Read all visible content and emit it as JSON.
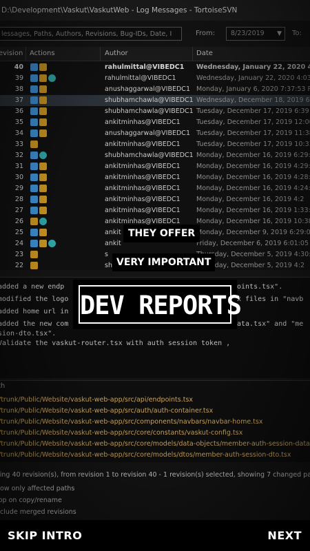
{
  "window": {
    "title": "D:\\Development\\Vaskut\\VaskutWeb - Log Messages - TortoiseSVN"
  },
  "filter": {
    "search_placeholder": "lessages, Paths, Authors, Revisions, Bug-IDs, Date, I",
    "from_label": "From:",
    "from_date": "8/23/2019",
    "to_label": "To:"
  },
  "log_table": {
    "columns": [
      "evision",
      "Actions",
      "Author",
      "Date"
    ],
    "rows": [
      {
        "rev": "40",
        "actions": [
          "a",
          "m"
        ],
        "author": "rahulmittal@VIBEDC1",
        "date": "Wednesday, January 22, 2020 4:0",
        "bold": true,
        "selected": false
      },
      {
        "rev": "39",
        "actions": [
          "a",
          "m",
          "d"
        ],
        "author": "rahulmittal@VIBEDC1",
        "date": "Wednesday, January 22, 2020 4:03",
        "bold": false,
        "selected": false
      },
      {
        "rev": "38",
        "actions": [
          "a",
          "m"
        ],
        "author": "anushaggarwal@VIBEDC1",
        "date": "Monday, January 6, 2020 7:37:53 P",
        "bold": false,
        "selected": false
      },
      {
        "rev": "37",
        "actions": [
          "a",
          "m"
        ],
        "author": "shubhamchawla@VIBEDC1",
        "date": "Wednesday, December 18, 2019 6:",
        "bold": false,
        "selected": true
      },
      {
        "rev": "36",
        "actions": [
          "a",
          "m"
        ],
        "author": "shubhamchawla@VIBEDC1",
        "date": "Tuesday, December 17, 2019 6:39",
        "bold": false,
        "selected": false
      },
      {
        "rev": "35",
        "actions": [
          "a",
          "m"
        ],
        "author": "ankitminhas@VIBEDC1",
        "date": "Tuesday, December 17, 2019 12:00",
        "bold": false,
        "selected": false
      },
      {
        "rev": "34",
        "actions": [
          "a",
          "m"
        ],
        "author": "anushaggarwal@VIBEDC1",
        "date": "Tuesday, December 17, 2019 11:38",
        "bold": false,
        "selected": false
      },
      {
        "rev": "33",
        "actions": [
          "m"
        ],
        "author": "ankitminhas@VIBEDC1",
        "date": "Tuesday, December 17, 2019 10:33",
        "bold": false,
        "selected": false
      },
      {
        "rev": "32",
        "actions": [
          "a",
          "d"
        ],
        "author": "shubhamchawla@VIBEDC1",
        "date": "Monday, December 16, 2019 6:29:",
        "bold": false,
        "selected": false
      },
      {
        "rev": "31",
        "actions": [
          "a",
          "m"
        ],
        "author": "ankitminhas@VIBEDC1",
        "date": "Monday, December 16, 2019 4:29:",
        "bold": false,
        "selected": false
      },
      {
        "rev": "30",
        "actions": [
          "a",
          "m"
        ],
        "author": "ankitminhas@VIBEDC1",
        "date": "Monday, December 16, 2019 4:28:",
        "bold": false,
        "selected": false
      },
      {
        "rev": "29",
        "actions": [
          "a",
          "m"
        ],
        "author": "ankitminhas@VIBEDC1",
        "date": "Monday, December 16, 2019 4:24:",
        "bold": false,
        "selected": false
      },
      {
        "rev": "28",
        "actions": [
          "a",
          "m"
        ],
        "author": "ankitminhas@VIBEDC1",
        "date": "Monday, December 16, 2019 4:2",
        "bold": false,
        "selected": false
      },
      {
        "rev": "27",
        "actions": [
          "a",
          "m"
        ],
        "author": "ankitminhas@VIBEDC1",
        "date": "Monday, December 16, 2019 1:33:",
        "bold": false,
        "selected": false
      },
      {
        "rev": "26",
        "actions": [
          "m",
          "d"
        ],
        "author": "ankitminhas@VIBEDC1",
        "date": "Monday, December 16, 2019 10:38",
        "bold": false,
        "selected": false
      },
      {
        "rev": "25",
        "actions": [
          "a",
          "m"
        ],
        "author": "ankit",
        "date": "Monday, December 9, 2019 6:29:0",
        "bold": false,
        "selected": false
      },
      {
        "rev": "24",
        "actions": [
          "a",
          "m",
          "d"
        ],
        "author": "ankit",
        "date": "Friday, December 6, 2019 6:01:05 P",
        "bold": false,
        "selected": false
      },
      {
        "rev": "23",
        "actions": [
          "m"
        ],
        "author": "s",
        "date": "Thursday, December 5, 2019 4:30:2",
        "bold": false,
        "selected": false
      },
      {
        "rev": "22",
        "actions": [
          "m"
        ],
        "author": "sh",
        "date": "Thursday, December 5, 2019 4:2",
        "bold": false,
        "selected": false
      }
    ]
  },
  "message": {
    "lines": [
      "added a new endp",
      "modified the logo",
      "added home url in",
      "added the new com",
      "sion-dto.tsx\".",
      "Validate the vaskut-router.tsx with auth session token ,"
    ],
    "fragments": [
      "oints.tsx\".",
      "x files in \"navb",
      "ata.tsx\" and \"me"
    ]
  },
  "paths": {
    "header": "th",
    "rows": [
      "/trunk/Public/Website/vaskut-web-app/src/api/endpoints.tsx",
      "/trunk/Public/Website/vaskut-web-app/src/auth/auth-container.tsx",
      "/trunk/Public/Website/vaskut-web-app/src/components/navbars/navbar-home.tsx",
      "/trunk/Public/Website/vaskut-web-app/src/core/constants/vaskut-config.tsx",
      "/trunk/Public/Website/vaskut-web-app/src/core/models/data-objects/member-auth-session-data.tsx",
      "/trunk/Public/Website/vaskut-web-app/src/core/models/dtos/member-auth-session-dto.tsx"
    ]
  },
  "status": {
    "text": "wing 40 revision(s), from revision 1 to revision 40 - 1 revision(s) selected, showing 7 changed paths"
  },
  "options": {
    "affected": "how only affected paths",
    "stop_copy": "top on copy/rename",
    "merged": "nclude merged revisions"
  },
  "overlay": {
    "line1": "THEY OFFER",
    "line2": "VERY IMPORTANT",
    "line3": "DEV REPORTS"
  },
  "nav": {
    "skip_label": "SKIP INTRO",
    "next_label": "NEXT"
  },
  "colors": {
    "action_modified": "#c89422",
    "action_added": "#3f8fd0",
    "action_deleted": "#2fa5a5",
    "path_text": "#c7a560"
  }
}
